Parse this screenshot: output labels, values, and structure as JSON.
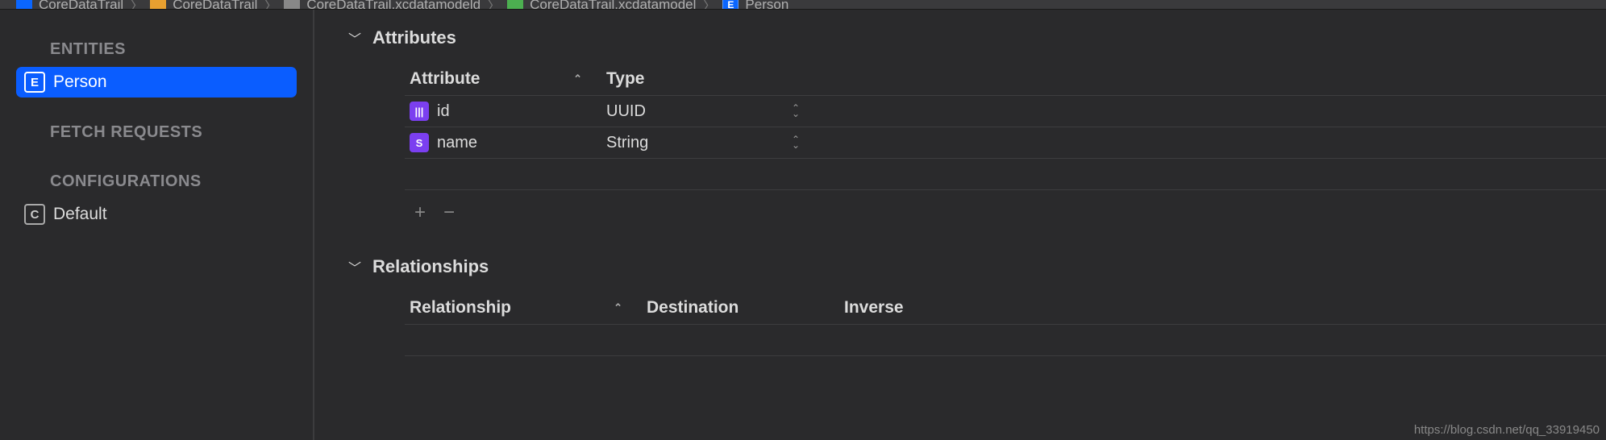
{
  "breadcrumb": [
    {
      "icon": "proj",
      "label": "CoreDataTrail"
    },
    {
      "icon": "folder",
      "label": "CoreDataTrail"
    },
    {
      "icon": "file",
      "label": "CoreDataTrail.xcdatamodeld"
    },
    {
      "icon": "model",
      "label": "CoreDataTrail.xcdatamodel"
    },
    {
      "icon": "entity",
      "label": "Person"
    }
  ],
  "sidebar": {
    "entities_header": "ENTITIES",
    "fetch_header": "FETCH REQUESTS",
    "config_header": "CONFIGURATIONS",
    "entities": [
      {
        "name": "Person",
        "selected": true
      }
    ],
    "configs": [
      {
        "name": "Default"
      }
    ]
  },
  "attributes_section": {
    "title": "Attributes",
    "columns": {
      "attr": "Attribute",
      "type": "Type"
    },
    "rows": [
      {
        "icon": "|||",
        "icon_class": "attr-uuid",
        "name": "id",
        "type": "UUID"
      },
      {
        "icon": "S",
        "icon_class": "attr-string",
        "name": "name",
        "type": "String"
      }
    ]
  },
  "relationships_section": {
    "title": "Relationships",
    "columns": {
      "rel": "Relationship",
      "dest": "Destination",
      "inv": "Inverse"
    },
    "rows": []
  },
  "watermark": "https://blog.csdn.net/qq_33919450"
}
